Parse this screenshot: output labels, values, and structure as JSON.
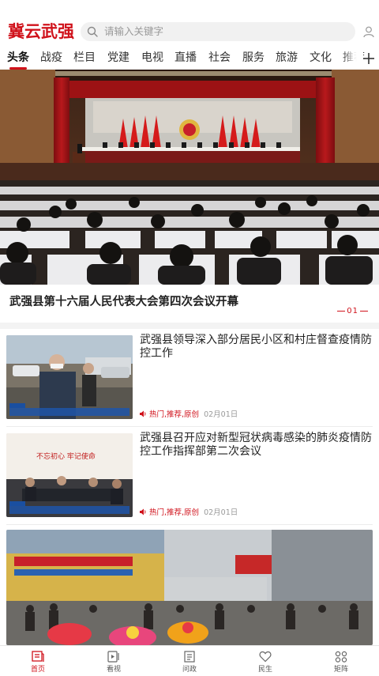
{
  "app": {
    "logo": "冀云武强"
  },
  "search": {
    "placeholder": "请输入关键字"
  },
  "tabs": [
    "头条",
    "战疫",
    "栏目",
    "党建",
    "电视",
    "直播",
    "社会",
    "服务",
    "旅游",
    "文化",
    "推荐"
  ],
  "hero": {
    "title": "武强县第十六届人民代表大会第四次会议开幕",
    "index": "01"
  },
  "news": [
    {
      "title": "武强县领导深入部分居民小区和村庄督查疫情防控工作",
      "tags": "热门,推荐,原创",
      "date": "02月01日"
    },
    {
      "title": "武强县召开应对新型冠状病毒感染的肺炎疫情防控工作指挥部第二次会议",
      "tags": "热门,推荐,原创",
      "date": "02月01日"
    }
  ],
  "bottom_nav": [
    {
      "label": "首页",
      "icon": "home-news-icon",
      "active": true
    },
    {
      "label": "看视",
      "icon": "video-icon"
    },
    {
      "label": "问政",
      "icon": "inquiry-icon"
    },
    {
      "label": "民生",
      "icon": "heart-icon"
    },
    {
      "label": "矩阵",
      "icon": "matrix-grid-icon"
    }
  ],
  "colors": {
    "accent": "#d0121b"
  }
}
